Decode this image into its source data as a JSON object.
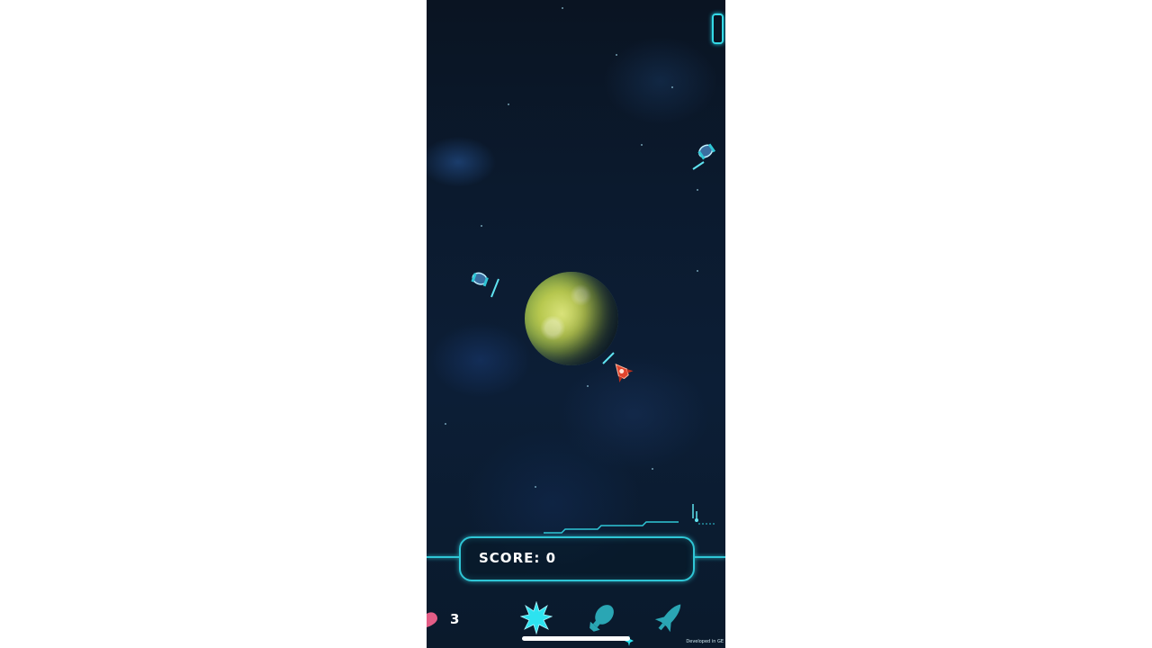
{
  "hud": {
    "score_label": "SCORE: 0",
    "lives": "3"
  },
  "powerups": [
    {
      "icon": "burst-icon"
    },
    {
      "icon": "bomb-icon"
    },
    {
      "icon": "rocket-icon"
    }
  ],
  "colors": {
    "accent": "#2fc6d6",
    "heart": "#e35d86",
    "player_ship": "#e0452d",
    "background": "#0b1a2e"
  },
  "footer": {
    "credit": "Developed in GE"
  }
}
